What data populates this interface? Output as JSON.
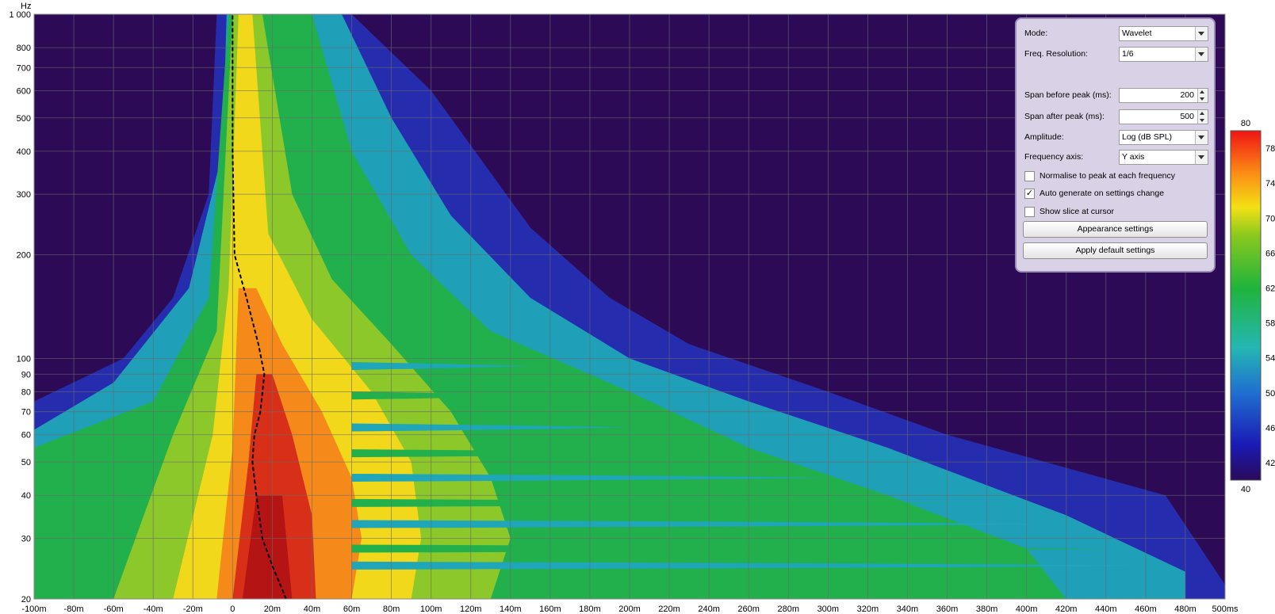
{
  "chart_data": {
    "type": "heatmap",
    "title": "",
    "xlabel": "",
    "ylabel": "Hz",
    "x_scale": "linear",
    "y_scale": "log",
    "xlim_ms": [
      -100,
      500
    ],
    "ylim_hz": [
      20,
      1000
    ],
    "x_ticks": [
      -100,
      -80,
      -60,
      -40,
      -20,
      0,
      20,
      40,
      60,
      80,
      100,
      120,
      140,
      160,
      180,
      200,
      220,
      240,
      260,
      280,
      300,
      320,
      340,
      360,
      380,
      400,
      420,
      440,
      460,
      480,
      500
    ],
    "x_tick_labels": [
      "-100m",
      "-80m",
      "-60m",
      "-40m",
      "-20m",
      "0",
      "20m",
      "40m",
      "60m",
      "80m",
      "100m",
      "120m",
      "140m",
      "160m",
      "180m",
      "200m",
      "220m",
      "240m",
      "260m",
      "280m",
      "300m",
      "320m",
      "340m",
      "360m",
      "380m",
      "400m",
      "420m",
      "440m",
      "460m",
      "480m",
      "500ms"
    ],
    "y_ticks": [
      20,
      30,
      40,
      50,
      60,
      70,
      80,
      90,
      100,
      200,
      300,
      400,
      500,
      600,
      700,
      800,
      1000
    ],
    "y_tick_labels": [
      "20",
      "30",
      "40",
      "50",
      "60",
      "70",
      "80",
      "90",
      "100",
      "200",
      "300",
      "400",
      "500",
      "600",
      "700",
      "800",
      "1 000"
    ],
    "grid": true,
    "colorbar": {
      "min": 40,
      "max": 80,
      "ticks": [
        42,
        46,
        50,
        54,
        58,
        62,
        66,
        70,
        74,
        78
      ],
      "min_label": "40",
      "max_label": "80"
    },
    "peak_time_curve_ms": [
      {
        "hz": 20,
        "ms": 27
      },
      {
        "hz": 25,
        "ms": 20
      },
      {
        "hz": 30,
        "ms": 15
      },
      {
        "hz": 40,
        "ms": 12
      },
      {
        "hz": 50,
        "ms": 10
      },
      {
        "hz": 60,
        "ms": 11
      },
      {
        "hz": 70,
        "ms": 14
      },
      {
        "hz": 90,
        "ms": 16
      },
      {
        "hz": 110,
        "ms": 13
      },
      {
        "hz": 150,
        "ms": 7
      },
      {
        "hz": 165,
        "ms": 5
      },
      {
        "hz": 200,
        "ms": 1
      },
      {
        "hz": 400,
        "ms": 0
      },
      {
        "hz": 1000,
        "ms": 0
      }
    ],
    "colors": {
      "background": "#2d0a55",
      "low": "#3b1490",
      "mid": "#22b14c",
      "high": "#ffd400",
      "max": "#c01414"
    }
  },
  "panel": {
    "mode_label": "Mode:",
    "mode_value": "Wavelet",
    "freq_res_label": "Freq. Resolution:",
    "freq_res_value": "1/6",
    "span_before_label": "Span before peak (ms):",
    "span_before_value": "200",
    "span_after_label": "Span after peak (ms):",
    "span_after_value": "500",
    "amplitude_label": "Amplitude:",
    "amplitude_value": "Log (dB SPL)",
    "freq_axis_label": "Frequency axis:",
    "freq_axis_value": "Y axis",
    "normalise_label": "Normalise to peak at each frequency",
    "normalise_checked": false,
    "autogen_label": "Auto generate on settings change",
    "autogen_checked": true,
    "slice_label": "Show slice at cursor",
    "slice_checked": false,
    "appearance_button": "Appearance settings",
    "defaults_button": "Apply default settings"
  }
}
